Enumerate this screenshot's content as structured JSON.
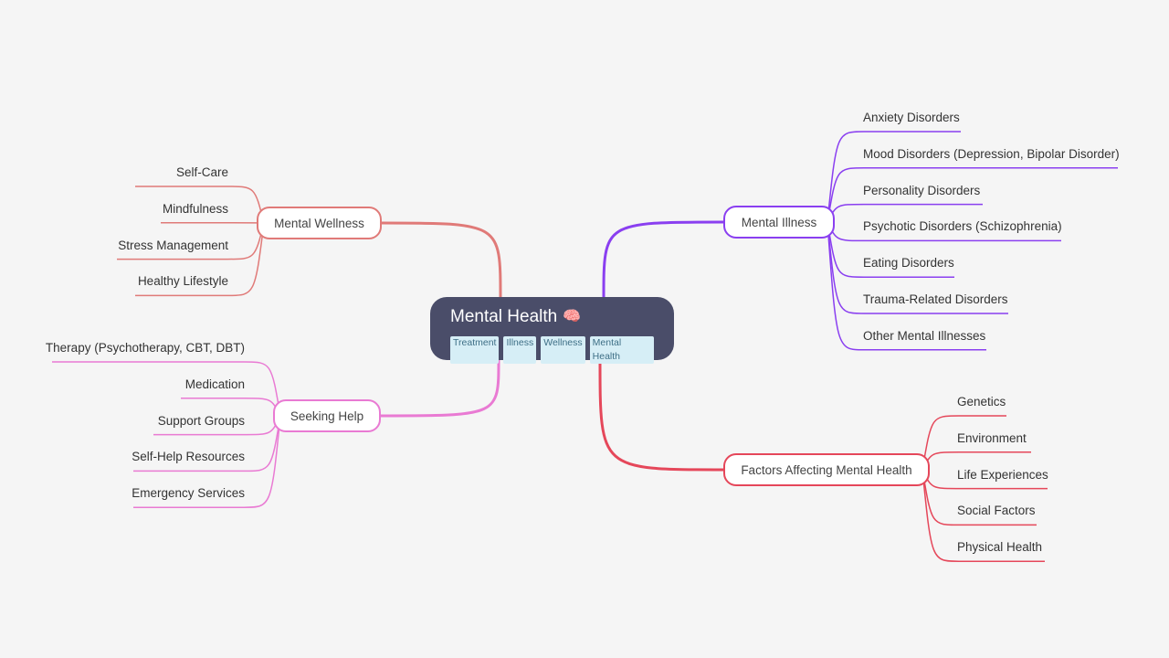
{
  "root": {
    "title": "Mental Health",
    "emoji": "🧠",
    "tags": [
      "Treatment",
      "Illness",
      "Wellness",
      "Mental Health"
    ]
  },
  "branches": [
    {
      "id": "mental-wellness",
      "label": "Mental Wellness",
      "color": "#e07a78",
      "side": "left",
      "children": [
        "Self-Care",
        "Mindfulness",
        "Stress Management",
        "Healthy Lifestyle"
      ]
    },
    {
      "id": "seeking-help",
      "label": "Seeking Help",
      "color": "#e97ad3",
      "side": "left",
      "children": [
        "Therapy (Psychotherapy, CBT, DBT)",
        "Medication",
        "Support Groups",
        "Self-Help Resources",
        "Emergency Services"
      ]
    },
    {
      "id": "mental-illness",
      "label": "Mental Illness",
      "color": "#8a3ff0",
      "side": "right",
      "children": [
        "Anxiety Disorders",
        "Mood Disorders (Depression, Bipolar Disorder)",
        "Personality Disorders",
        "Psychotic Disorders (Schizophrenia)",
        "Eating Disorders",
        "Trauma-Related Disorders",
        "Other Mental Illnesses"
      ]
    },
    {
      "id": "factors-affecting",
      "label": "Factors Affecting Mental Health",
      "color": "#e5475a",
      "side": "right",
      "children": [
        "Genetics",
        "Environment",
        "Life Experiences",
        "Social Factors",
        "Physical Health"
      ]
    }
  ]
}
